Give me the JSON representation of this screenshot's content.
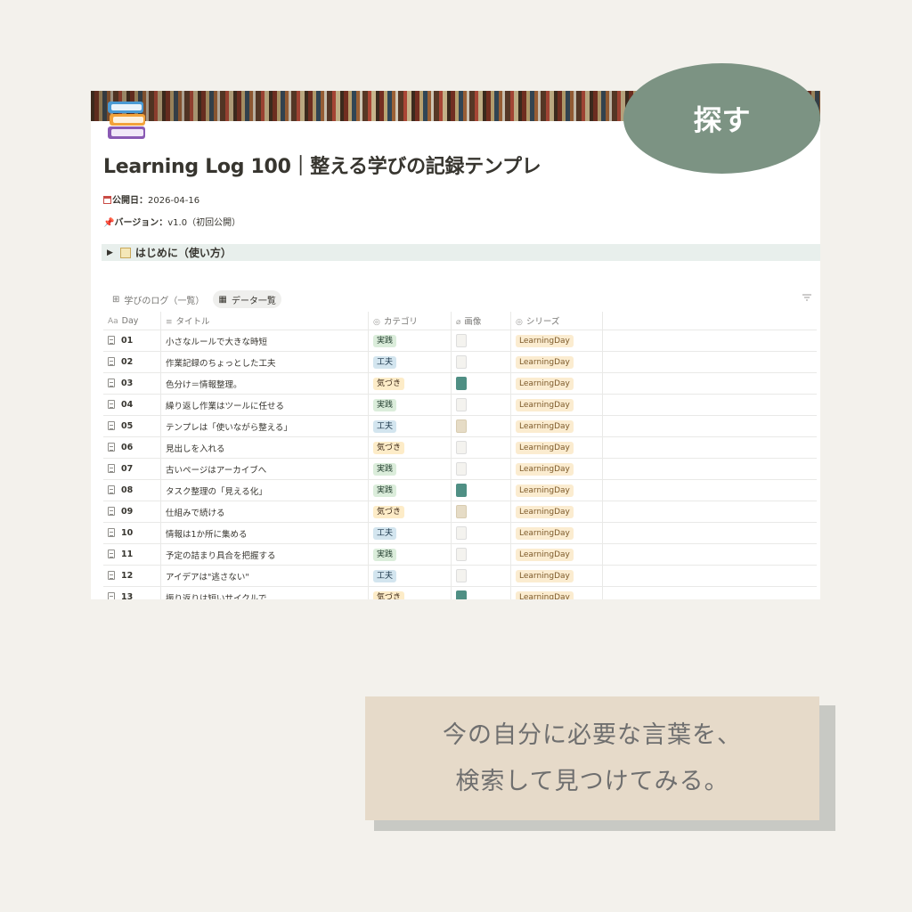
{
  "page": {
    "title": "Learning Log 100｜整える学びの記録テンプレ",
    "published_label": "公開日：",
    "published_value": "2026-04-16",
    "version_label": "バージョン：",
    "version_value": "v1.0（初回公開）",
    "toggle_label": "はじめに（使い方）"
  },
  "views": [
    {
      "label": "学びのログ（一覧）",
      "icon": "gallery-icon",
      "active": false
    },
    {
      "label": "データ一覧",
      "icon": "table-icon",
      "active": true
    }
  ],
  "table": {
    "columns": [
      {
        "label": "Day",
        "icon": "aa-icon"
      },
      {
        "label": "タイトル",
        "icon": "text-lines-icon"
      },
      {
        "label": "カテゴリ",
        "icon": "select-icon"
      },
      {
        "label": "画像",
        "icon": "paperclip-icon"
      },
      {
        "label": "シリーズ",
        "icon": "select-icon"
      }
    ],
    "rows": [
      {
        "day": "01",
        "title": "小さなルールで大きな時短",
        "category": "実践",
        "series": "LearningDay"
      },
      {
        "day": "02",
        "title": "作業記録のちょっとした工夫",
        "category": "工夫",
        "series": "LearningDay"
      },
      {
        "day": "03",
        "title": "色分け＝情報整理。",
        "category": "気づき",
        "series": "LearningDay"
      },
      {
        "day": "04",
        "title": "繰り返し作業はツールに任せる",
        "category": "実践",
        "series": "LearningDay"
      },
      {
        "day": "05",
        "title": "テンプレは「使いながら整える」",
        "category": "工夫",
        "series": "LearningDay"
      },
      {
        "day": "06",
        "title": "見出しを入れる",
        "category": "気づき",
        "series": "LearningDay"
      },
      {
        "day": "07",
        "title": "古いページはアーカイブへ",
        "category": "実践",
        "series": "LearningDay"
      },
      {
        "day": "08",
        "title": "タスク整理の「見える化」",
        "category": "実践",
        "series": "LearningDay"
      },
      {
        "day": "09",
        "title": "仕組みで続ける",
        "category": "気づき",
        "series": "LearningDay"
      },
      {
        "day": "10",
        "title": "情報は1か所に集める",
        "category": "工夫",
        "series": "LearningDay"
      },
      {
        "day": "11",
        "title": "予定の詰まり具合を把握する",
        "category": "実践",
        "series": "LearningDay"
      },
      {
        "day": "12",
        "title": "アイデアは\"逃さない\"",
        "category": "工夫",
        "series": "LearningDay"
      },
      {
        "day": "13",
        "title": "振り返りは短いサイクルで",
        "category": "気づき",
        "series": "LearningDay"
      }
    ]
  },
  "badge": {
    "text": "探す"
  },
  "caption": {
    "line1": "今の自分に必要な言葉を、",
    "line2": "検索して見つけてみる。"
  },
  "colors": {
    "badge_bg": "#7c9383",
    "caption_bg": "#e6dac9",
    "page_bg": "#f3f1ec",
    "toggle_bg": "#e8efec"
  }
}
